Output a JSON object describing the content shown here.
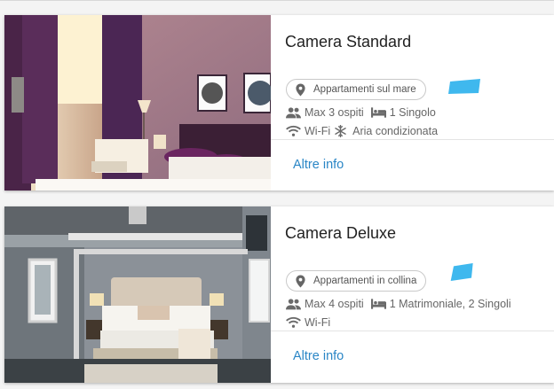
{
  "rooms": [
    {
      "title": "Camera Standard",
      "location": "Appartamenti sul mare",
      "guests": "Max 3 ospiti",
      "beds": "1 Singolo",
      "amenities": [
        "Wi-Fi",
        "Aria condizionata"
      ],
      "more_label": "Altre info"
    },
    {
      "title": "Camera Deluxe",
      "location": "Appartamenti in collina",
      "guests": "Max 4 ospiti",
      "beds": "1 Matrimoniale, 2 Singoli",
      "amenities": [
        "Wi-Fi"
      ],
      "more_label": "Altre info"
    }
  ],
  "colors": {
    "link": "#2a86c6",
    "highlight": "#3fb8ee",
    "icon": "#6a6a6a"
  },
  "icons": {
    "location": "map-pin-icon",
    "guests": "people-icon",
    "bed": "bed-icon",
    "wifi": "wifi-icon",
    "ac": "snowflake-icon"
  }
}
